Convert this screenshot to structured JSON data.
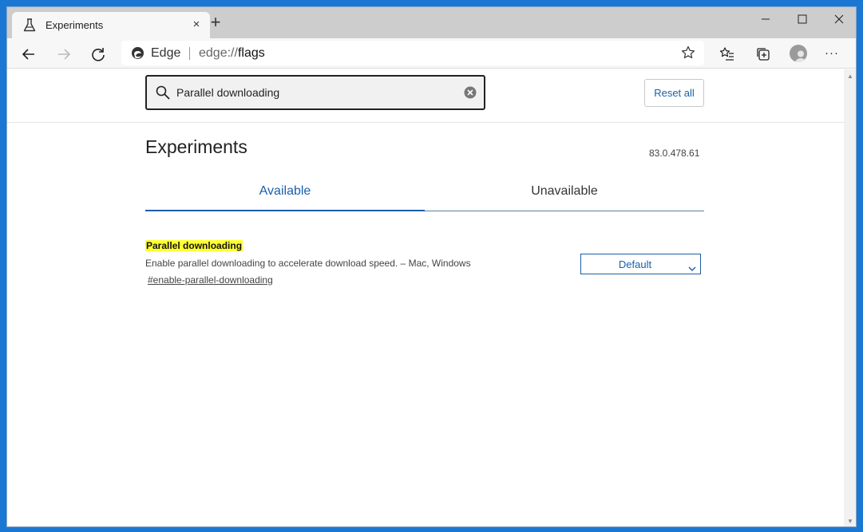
{
  "tab": {
    "title": "Experiments",
    "close_glyph": "×",
    "new_tab_glyph": "+"
  },
  "icons": {
    "tab_icon": "flask-icon",
    "back": "back-arrow-icon",
    "forward": "forward-arrow-icon",
    "reload": "reload-icon",
    "browser_logo": "edge-logo-icon",
    "favorite": "star-icon",
    "favorites_list": "favorites-icon",
    "collections": "collections-icon",
    "profile": "avatar-icon",
    "menu": "more-icon",
    "search": "search-icon",
    "clear": "clear-icon",
    "dropdown": "chevron-down-icon"
  },
  "address": {
    "label": "Edge",
    "url_prefix": "edge://",
    "url_path": "flags"
  },
  "toolbar": {
    "menu_glyph": "···"
  },
  "search": {
    "value": "Parallel downloading"
  },
  "actions": {
    "reset_label": "Reset all"
  },
  "page": {
    "title": "Experiments",
    "version": "83.0.478.61",
    "tabs": [
      {
        "label": "Available",
        "selected": true
      },
      {
        "label": "Unavailable",
        "selected": false
      }
    ]
  },
  "experiment": {
    "name": "Parallel downloading",
    "description": "Enable parallel downloading to accelerate download speed. – Mac, Windows",
    "anchor": "#enable-parallel-downloading",
    "selected_option": "Default"
  },
  "colors": {
    "accent": "#1b5fa8",
    "highlight": "#ffff33",
    "desktop": "#1a78d4",
    "tabstrip": "#cdcdcd"
  }
}
